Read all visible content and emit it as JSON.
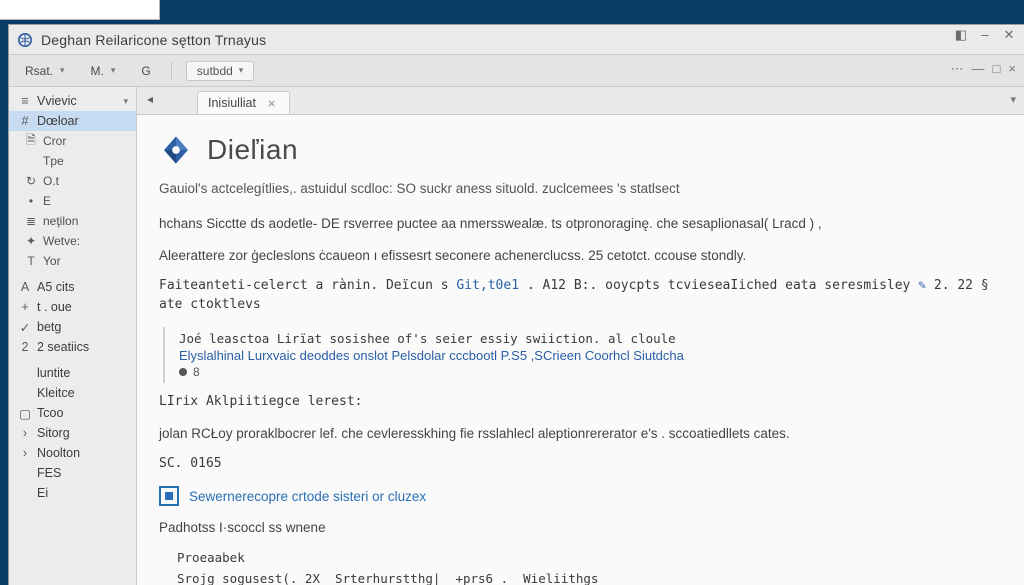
{
  "window": {
    "title": "Deghan  Reilaricone sętton Trnayus",
    "controls": {
      "restore": "◧",
      "min": "–",
      "close": "✕"
    }
  },
  "toolbar": {
    "items": [
      "Rsat.",
      "M.",
      "G"
    ],
    "pill_label": "sutbdd",
    "right_btn": "⋯"
  },
  "sidebar_top_label": "Vvievic",
  "sidebar": [
    {
      "icon": "hash",
      "label": "Dœloar",
      "selected": true
    },
    {
      "icon": "doc",
      "label": "Cror",
      "small": true
    },
    {
      "icon": "none",
      "label": "Tpe",
      "small": true
    },
    {
      "icon": "refresh",
      "label": "O.t",
      "small": true
    },
    {
      "icon": "dot",
      "label": "E",
      "small": true
    },
    {
      "icon": "list",
      "label": "neţilon",
      "small": true
    },
    {
      "icon": "star",
      "label": "Wetve:",
      "small": true
    },
    {
      "icon": "T",
      "label": "Yor",
      "small": true
    },
    {
      "icon": "A",
      "label": "A5 cits"
    },
    {
      "icon": "plus",
      "label": "t . oue"
    },
    {
      "icon": "check",
      "label": "betg"
    },
    {
      "icon": "num",
      "label": "2  seatiics"
    },
    {
      "icon": "none",
      "label": "luntite"
    },
    {
      "icon": "none",
      "label": "Kleitce"
    },
    {
      "icon": "box",
      "label": "Tcoo"
    },
    {
      "icon": "chev",
      "label": "Sitorg"
    },
    {
      "icon": "chev",
      "label": "Noolton"
    },
    {
      "icon": "none",
      "label": "FES"
    },
    {
      "icon": "none",
      "label": "Ei"
    }
  ],
  "tabs": {
    "left_label": "◂",
    "active": "Inisiulliat",
    "close": "⨯",
    "drop": "▾"
  },
  "article": {
    "title": "Dieľian",
    "lead": "Gauiol's actcelegítlies,. astuidul scdloc:   SO suckr aness situold. zuclcemees 's statlsect",
    "p1": "hchans Sicctte ds aodetle- DE rsverree puctee aa nmersswealæ. ts otpronoraginę. che sesaplionasal( Lracd ) ,",
    "p2": "Aleerattere zor ģecleslons ċcaueon ı efissesrt seconere achenerclucss. 25 cetotct. ccouse stondly.",
    "p3_pre": "Faiteanteti-celerct a rànin.   Deïcun s ",
    "p3_link": "Git,t0e1",
    "p3_mid": " .  A12 B:. ooycpts tcvieseaIiched eata seresmisley ",
    "p3_tail": " 2. 22 § ate ctoktlevs",
    "bullet_lead": "Joé leasctoa Lirїat sosishee of's seier essiy swiiction. al cloule",
    "bullet_link": "Elyslalhinal  Lurxvaic deoddes onslot Pelsdolar cccbootl  P.S5 ,SCrieen  Coorhcl Siutdcha",
    "bullet_sub": "8",
    "p4_label": "LIrix Aklpiitiegce lerest:",
    "p5": "jolan RCŁoy proraklbocrer  lef.  che cevleresskhing fie rsslahlecl aleptionrererator e's . sccoatiedllets cates.",
    "sc_label": "SC.  0165",
    "callout_link": "Sewernerecopre crtode sisteri or cluzex",
    "p6": "Padhotss  I·scoccl ss wnene",
    "code1": "Proeaabek",
    "code2": "Srojg sogusest(. 2X  Srterhurstthg|  +prs6 .  Wieliithgs"
  }
}
